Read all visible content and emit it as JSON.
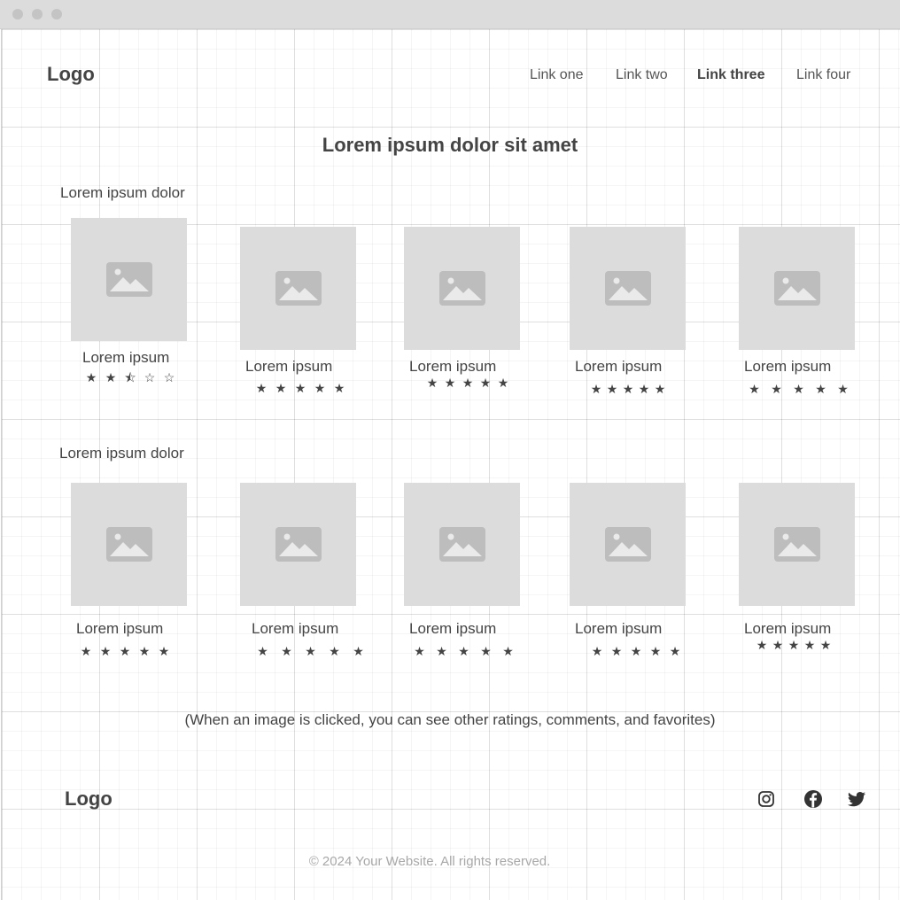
{
  "window": {
    "controls": [
      "close-dot",
      "minimize-dot",
      "maximize-dot"
    ]
  },
  "header": {
    "logo": "Logo",
    "nav": [
      {
        "label": "Link one",
        "active": false
      },
      {
        "label": "Link two",
        "active": false
      },
      {
        "label": "Link three",
        "active": true
      },
      {
        "label": "Link four",
        "active": false
      }
    ]
  },
  "main": {
    "title": "Lorem ipsum dolor sit amet",
    "sections": [
      {
        "title": "Lorem ipsum dolor",
        "items": [
          {
            "label": "Lorem ipsum",
            "stars": "★★⯪☆☆",
            "rating": 2.5
          },
          {
            "label": "Lorem ipsum",
            "stars": "★★★★★",
            "rating": 5
          },
          {
            "label": "Lorem ipsum",
            "stars": "★★★★★",
            "rating": 5
          },
          {
            "label": "Lorem ipsum",
            "stars": "★★★★★",
            "rating": 5
          },
          {
            "label": "Lorem ipsum",
            "stars": "★★★★★",
            "rating": 5
          }
        ]
      },
      {
        "title": "Lorem ipsum dolor",
        "items": [
          {
            "label": "Lorem ipsum",
            "stars": "★★★★★",
            "rating": 5
          },
          {
            "label": "Lorem ipsum",
            "stars": "★★★★★",
            "rating": 5
          },
          {
            "label": "Lorem ipsum",
            "stars": "★★★★★",
            "rating": 5
          },
          {
            "label": "Lorem ipsum",
            "stars": "★★★★★",
            "rating": 5
          },
          {
            "label": "Lorem ipsum",
            "stars": "★★★★★",
            "rating": 5
          }
        ]
      }
    ],
    "note": "(When an image is clicked, you can see other ratings, comments, and favorites)"
  },
  "footer": {
    "logo": "Logo",
    "social_icons": [
      "instagram-icon",
      "facebook-icon",
      "twitter-icon"
    ],
    "copyright": "© 2024 Your Website. All rights reserved."
  },
  "colors": {
    "placeholder": "#dcdcdc",
    "placeholder_icon": "#bdbdbd",
    "text": "#444444",
    "muted": "#a8a8a8"
  }
}
